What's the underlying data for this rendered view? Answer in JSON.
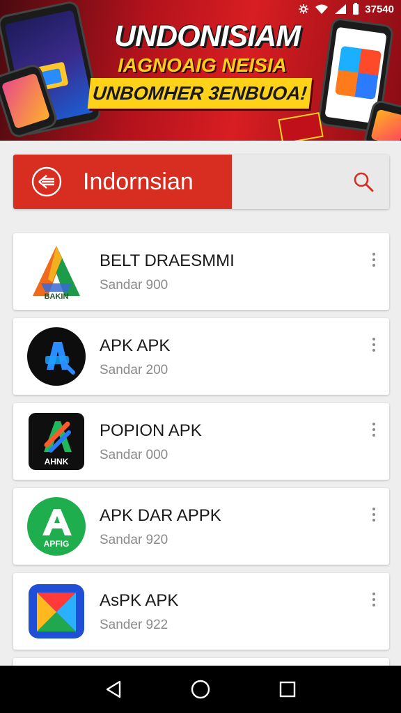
{
  "status_bar": {
    "time": "37540"
  },
  "banner": {
    "title": "UNDONISIAM",
    "subtitle": "IAGNOAIG NEISIA",
    "cta": "UNBOMHER 3ENBUOA!"
  },
  "search": {
    "label": "Indornsian"
  },
  "apps": [
    {
      "name": "BELT DRAESMMI",
      "meta": "Sandar 900",
      "icon_text": "BAKIN",
      "icon": "tricolor-a-icon"
    },
    {
      "name": "APK APK",
      "meta": "Sandar 200",
      "icon_text": "",
      "icon": "blue-a-icon"
    },
    {
      "name": "POPION APK",
      "meta": "Sandar 000",
      "icon_text": "AHNK",
      "icon": "dark-a-icon"
    },
    {
      "name": "APK DAR APPK",
      "meta": "Sandar 920",
      "icon_text": "APFIG",
      "icon": "green-a-icon"
    },
    {
      "name": "AsPK APK",
      "meta": "Sander 922",
      "icon_text": "",
      "icon": "kite-icon"
    }
  ],
  "colors": {
    "accent": "#d82d21",
    "nav": "#000000",
    "card": "#ffffff",
    "background": "#eeeeee"
  }
}
